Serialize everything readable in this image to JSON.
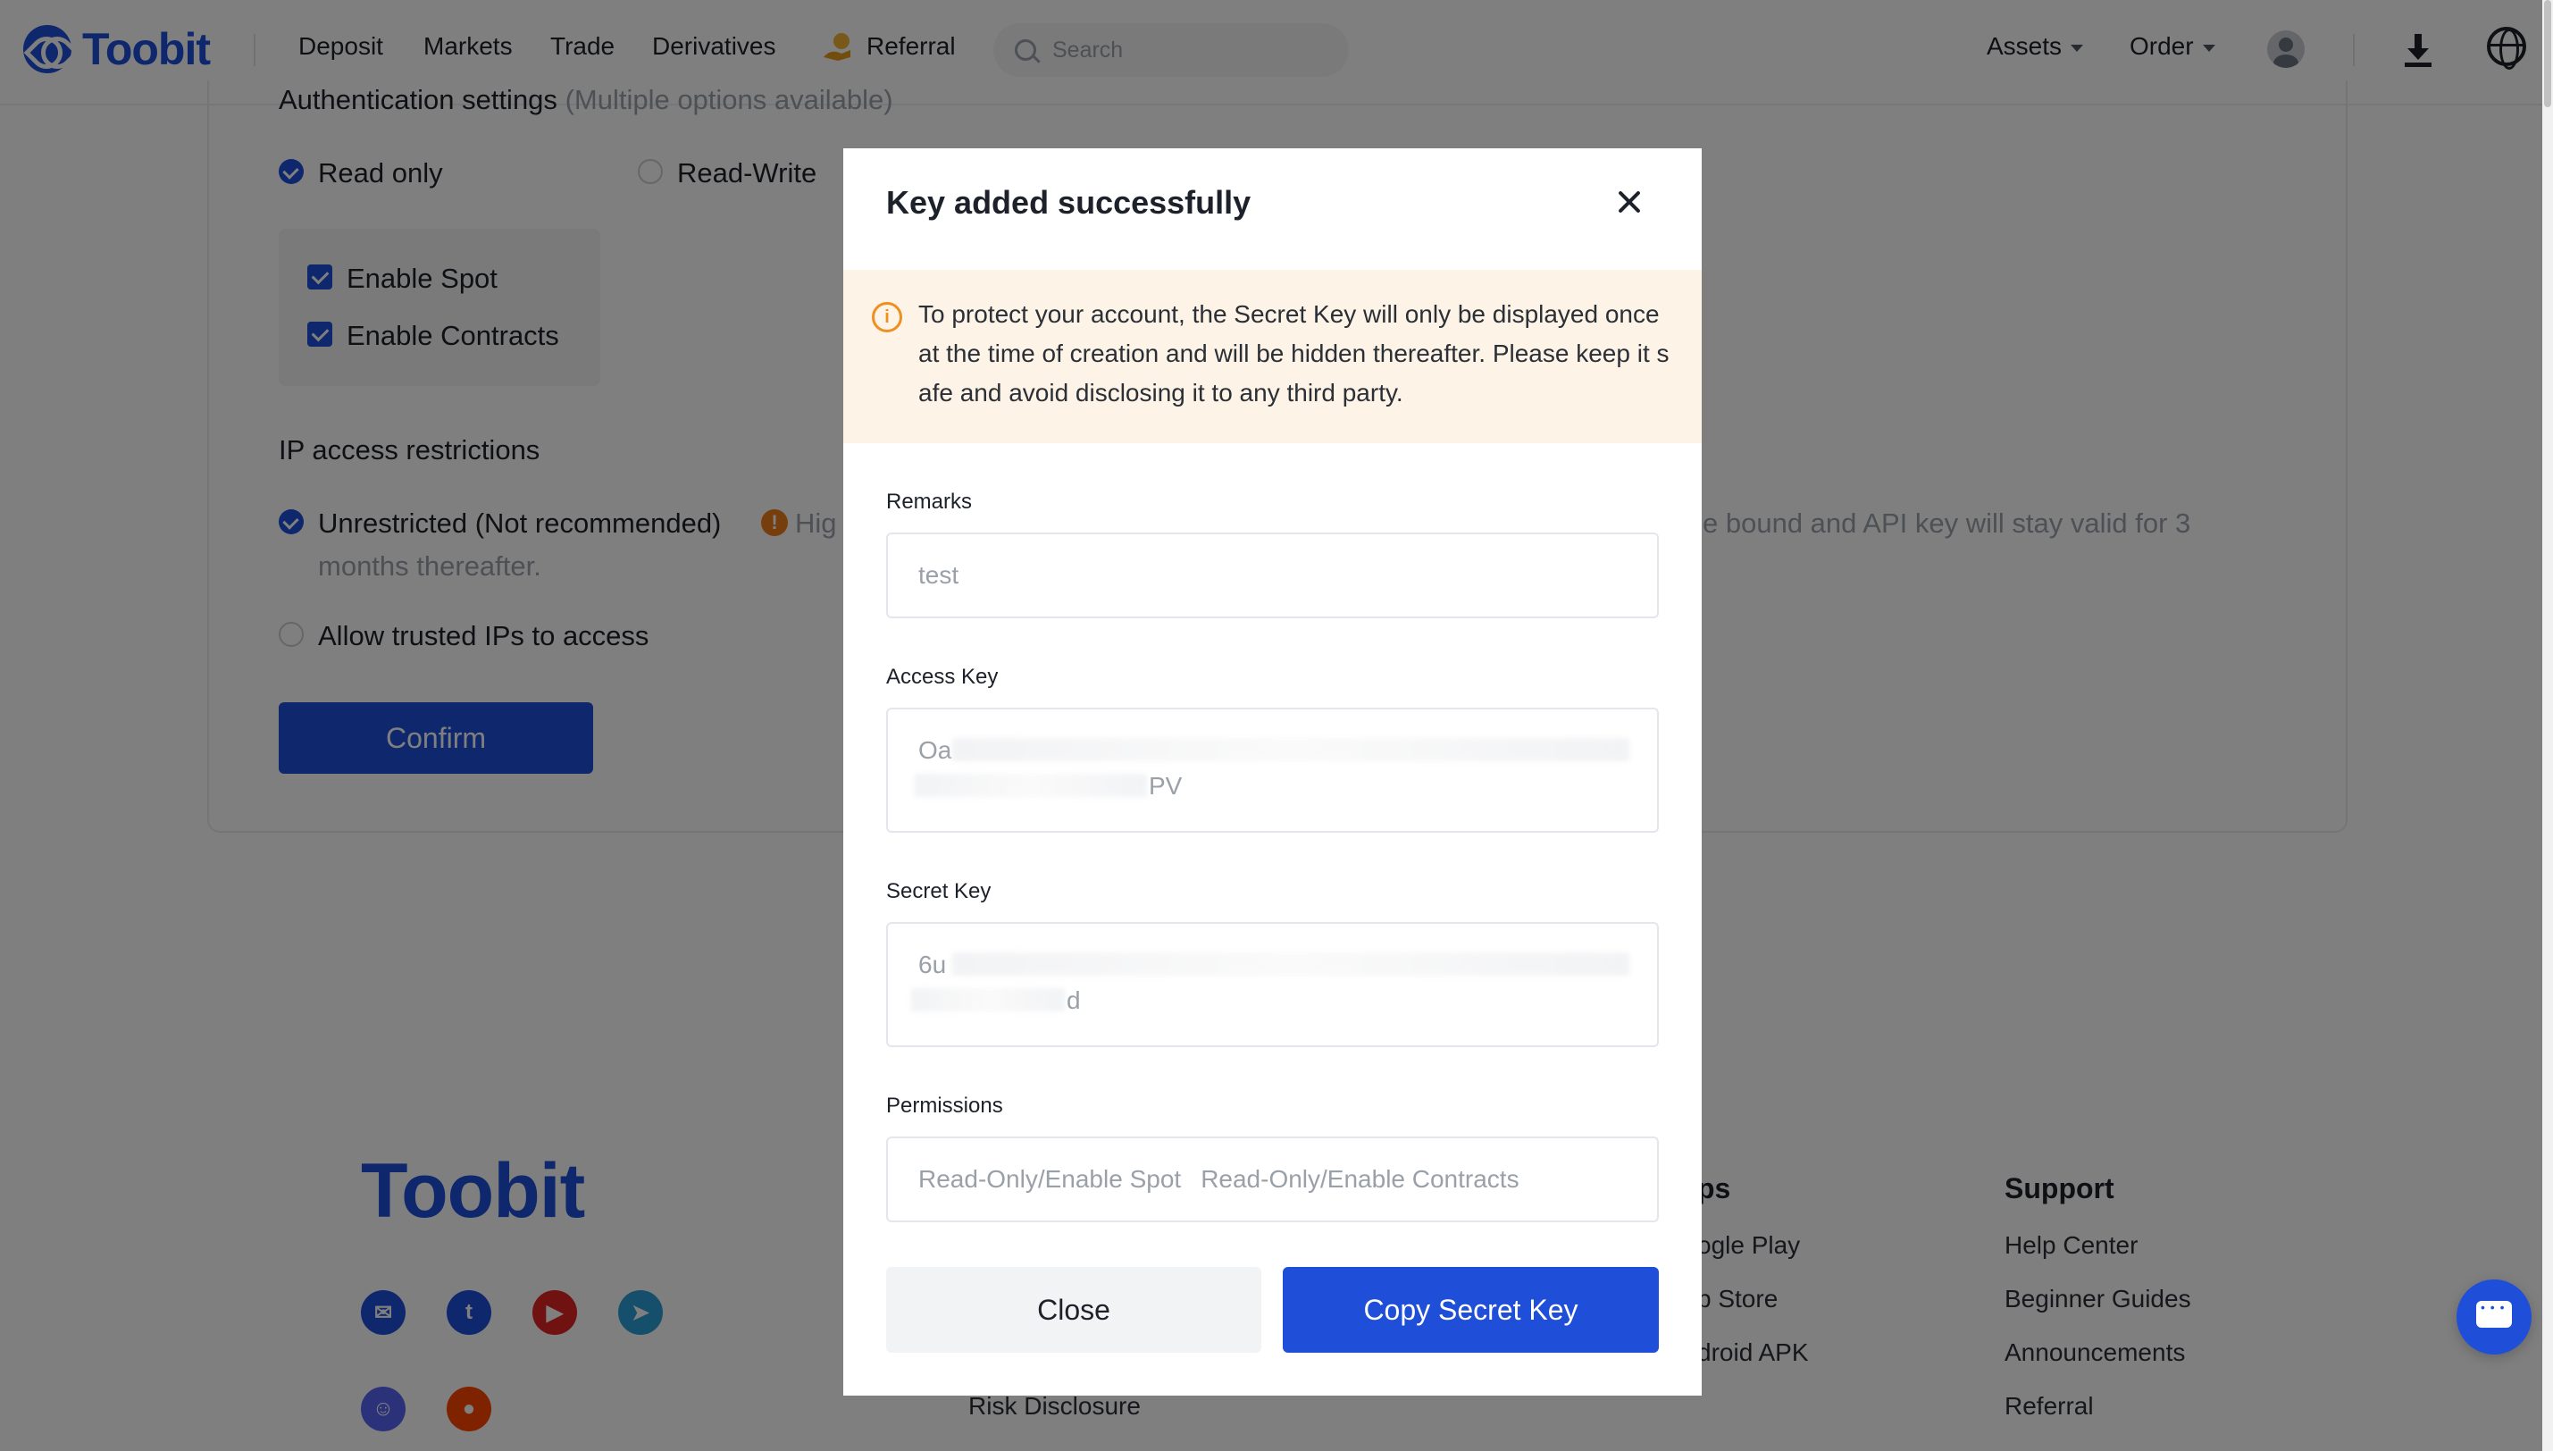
{
  "header": {
    "logo_text": "Toobit",
    "nav": [
      "Deposit",
      "Markets",
      "Trade",
      "Derivatives",
      "Referral"
    ],
    "search_placeholder": "Search",
    "assets_label": "Assets",
    "order_label": "Order"
  },
  "settings": {
    "auth_heading": "Authentication settings",
    "auth_hint": "(Multiple options available)",
    "read_only_label": "Read only",
    "read_write_label": "Read-Write",
    "enable_spot_label": "Enable Spot",
    "enable_contracts_label": "Enable Contracts",
    "ip_heading": "IP access restrictions",
    "unrestricted_label": "Unrestricted (Not recommended)",
    "unrestricted_warning_start": "Hig",
    "unrestricted_warning_end": "e bound and API key will stay valid for 3",
    "unrestricted_warning_line2": "months thereafter.",
    "trusted_ips_label": "Allow trusted IPs to access",
    "confirm_label": "Confirm"
  },
  "footer": {
    "logo_text": "Toobit",
    "apps_heading_partial": "ps",
    "apps_links": [
      "ogle Play",
      "p Store",
      "droid APK"
    ],
    "support_heading": "Support",
    "support_links": [
      "Help Center",
      "Beginner Guides",
      "Announcements",
      "Referral"
    ],
    "risk_disclosure": "Risk Disclosure",
    "social_icons": [
      "mail-icon",
      "twitter-icon",
      "youtube-icon",
      "telegram-icon",
      "discord-icon",
      "reddit-icon"
    ]
  },
  "modal": {
    "title": "Key added successfully",
    "notice": "To protect your account, the Secret Key will only be displayed once at the time of creation and will be hidden thereafter. Please keep it safe and avoid disclosing it to any third party.",
    "remarks_label": "Remarks",
    "remarks_value": "test",
    "access_key_label": "Access Key",
    "access_key_prefix": "Oa",
    "access_key_suffix": "PV",
    "secret_key_label": "Secret Key",
    "secret_key_prefix": "6u",
    "secret_key_suffix": "d",
    "permissions_label": "Permissions",
    "permissions": [
      "Read-Only/Enable Spot",
      "Read-Only/Enable Contracts"
    ],
    "close_label": "Close",
    "copy_label": "Copy Secret Key"
  },
  "colors": {
    "brand": "#1f4fd8",
    "notice_bg": "#fdf3e7",
    "warning": "#ee8f1f"
  }
}
